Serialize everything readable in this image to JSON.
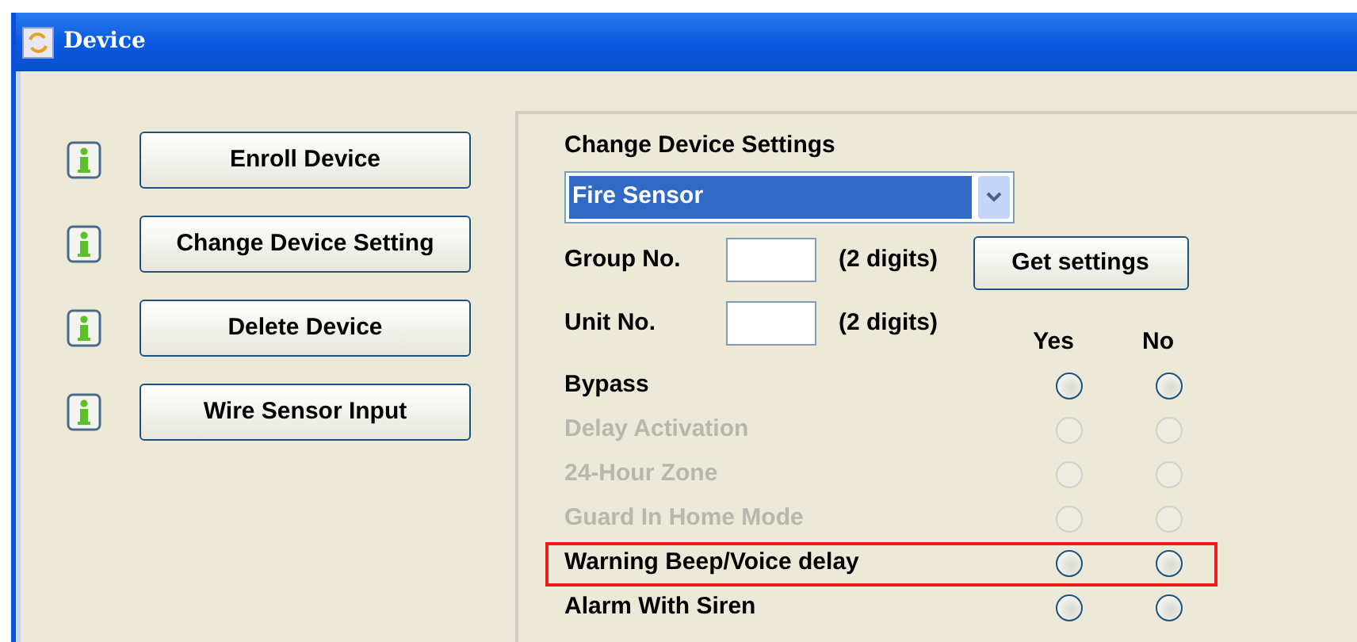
{
  "window": {
    "title": "Device"
  },
  "actions": [
    {
      "label": "Enroll Device"
    },
    {
      "label": "Change Device Setting"
    },
    {
      "label": "Delete Device"
    },
    {
      "label": "Wire Sensor Input"
    }
  ],
  "settings": {
    "heading": "Change Device Settings",
    "device_type": "Fire Sensor",
    "group": {
      "label": "Group No.",
      "hint": "(2 digits)"
    },
    "unit": {
      "label": "Unit No.",
      "hint": "(2 digits)"
    },
    "get_button": "Get settings",
    "columns": [
      "Yes",
      "No"
    ],
    "options": [
      {
        "label": "Bypass",
        "disabled": false,
        "highlighted": false,
        "yes_selected": false,
        "no_selected": false
      },
      {
        "label": "Delay Activation",
        "disabled": true,
        "highlighted": false,
        "yes_selected": false,
        "no_selected": false
      },
      {
        "label": "24-Hour Zone",
        "disabled": true,
        "highlighted": false,
        "yes_selected": false,
        "no_selected": false
      },
      {
        "label": "Guard In Home Mode",
        "disabled": true,
        "highlighted": false,
        "yes_selected": false,
        "no_selected": false
      },
      {
        "label": "Warning Beep/Voice delay",
        "disabled": false,
        "highlighted": true,
        "yes_selected": false,
        "no_selected": false
      },
      {
        "label": "Alarm With Siren",
        "disabled": false,
        "highlighted": false,
        "yes_selected": false,
        "no_selected": false
      }
    ]
  }
}
